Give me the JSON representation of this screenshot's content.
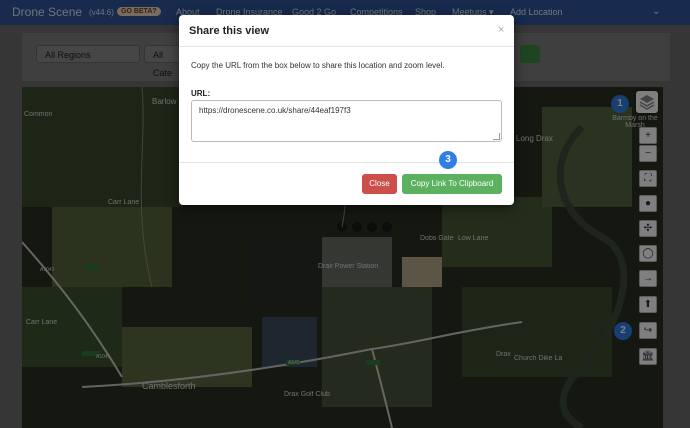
{
  "navbar": {
    "brand": "Drone Scene",
    "version": "(v44.6)",
    "beta_badge": "GO BETA?",
    "links": [
      "About",
      "Drone Insurance",
      "Good 2 Go",
      "Competitions",
      "Shop",
      "Meetups ▾",
      "Add Location"
    ],
    "toggle_icon": "chevron-down-icon"
  },
  "filters": {
    "region_select": "All Regions",
    "category_select": "All Cate"
  },
  "map": {
    "labels": [
      "Barlow",
      "Common",
      "Barmby on the Marsh",
      "Long Drax",
      "Camblesforth",
      "Drax Power Station",
      "Drax",
      "Church Dike La",
      "Drax Golf Club",
      "A1041",
      "A645",
      "A1041",
      "Carr Lane",
      "Dobs Gate",
      "Low Lane",
      "Carr Lane"
    ],
    "controls": [
      {
        "icon": "zoom-in-icon",
        "glyph": "+"
      },
      {
        "icon": "zoom-out-icon",
        "glyph": "−"
      },
      {
        "icon": "fullscreen-icon",
        "glyph": "⛶"
      },
      {
        "icon": "location-pin-icon",
        "glyph": "●"
      },
      {
        "icon": "crosshair-icon",
        "glyph": "✣"
      },
      {
        "icon": "circle-icon",
        "glyph": "◯"
      },
      {
        "icon": "arrow-right-icon",
        "glyph": "→"
      },
      {
        "icon": "arrow-up-icon",
        "glyph": "⬆"
      },
      {
        "icon": "share-icon",
        "glyph": "↪"
      },
      {
        "icon": "bank-icon",
        "glyph": "🏛"
      }
    ],
    "layers_icon": "layers-icon"
  },
  "callouts": [
    "1",
    "2",
    "3"
  ],
  "modal": {
    "title": "Share this view",
    "close_glyph": "×",
    "description": "Copy the URL from the box below to share this location and zoom level.",
    "url_label": "URL:",
    "url_value": "https://dronescene.co.uk/share/44eaf197f3",
    "close_button": "Close",
    "copy_button": "Copy Link To Clipboard"
  },
  "colors": {
    "navbar": "#31559a",
    "badge": "#2f7ee6",
    "close_button": "#cd4f4a",
    "copy_button": "#5cb160"
  }
}
